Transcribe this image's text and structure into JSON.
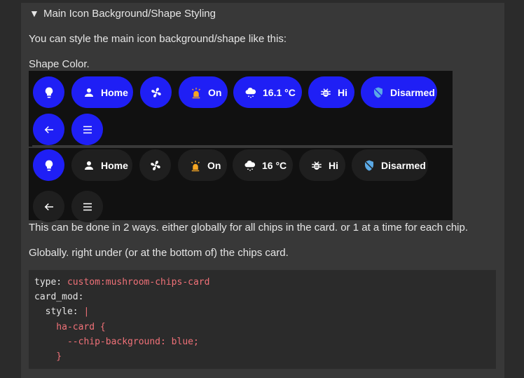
{
  "section": {
    "summary": "Main Icon Background/Shape Styling",
    "toggle_glyph": "▼"
  },
  "paragraphs": {
    "intro": "You can style the main icon background/shape like this:",
    "shape_color": "Shape Color.",
    "ways": "This can be done in 2 ways. either globally for all chips in the card. or 1 at a time for each chip.",
    "globally": "Globally. right under (or at the bottom of) the chips card."
  },
  "chips_blue": {
    "home": "Home",
    "on": "On",
    "temp": "16.1 °C",
    "hi": "Hi",
    "disarmed": "Disarmed"
  },
  "chips_dark": {
    "home": "Home",
    "on": "On",
    "temp": "16 °C",
    "hi": "Hi",
    "disarmed": "Disarmed"
  },
  "colors": {
    "chip_blue": "#1f1ff5",
    "chip_dark": "#1f1f1f",
    "shield_icon": "#5aa9e6",
    "alarm_icon": "#f5a623",
    "code_string": "#f07178"
  },
  "code": {
    "l1_key": "type: ",
    "l1_val": "custom:mushroom-chips-card",
    "l2_key": "card_mod:",
    "l3_key": "  style: ",
    "l3_val": "|",
    "l4_val": "    ha-card {",
    "l5_val": "      --chip-background: blue;",
    "l6_val": "    }"
  }
}
